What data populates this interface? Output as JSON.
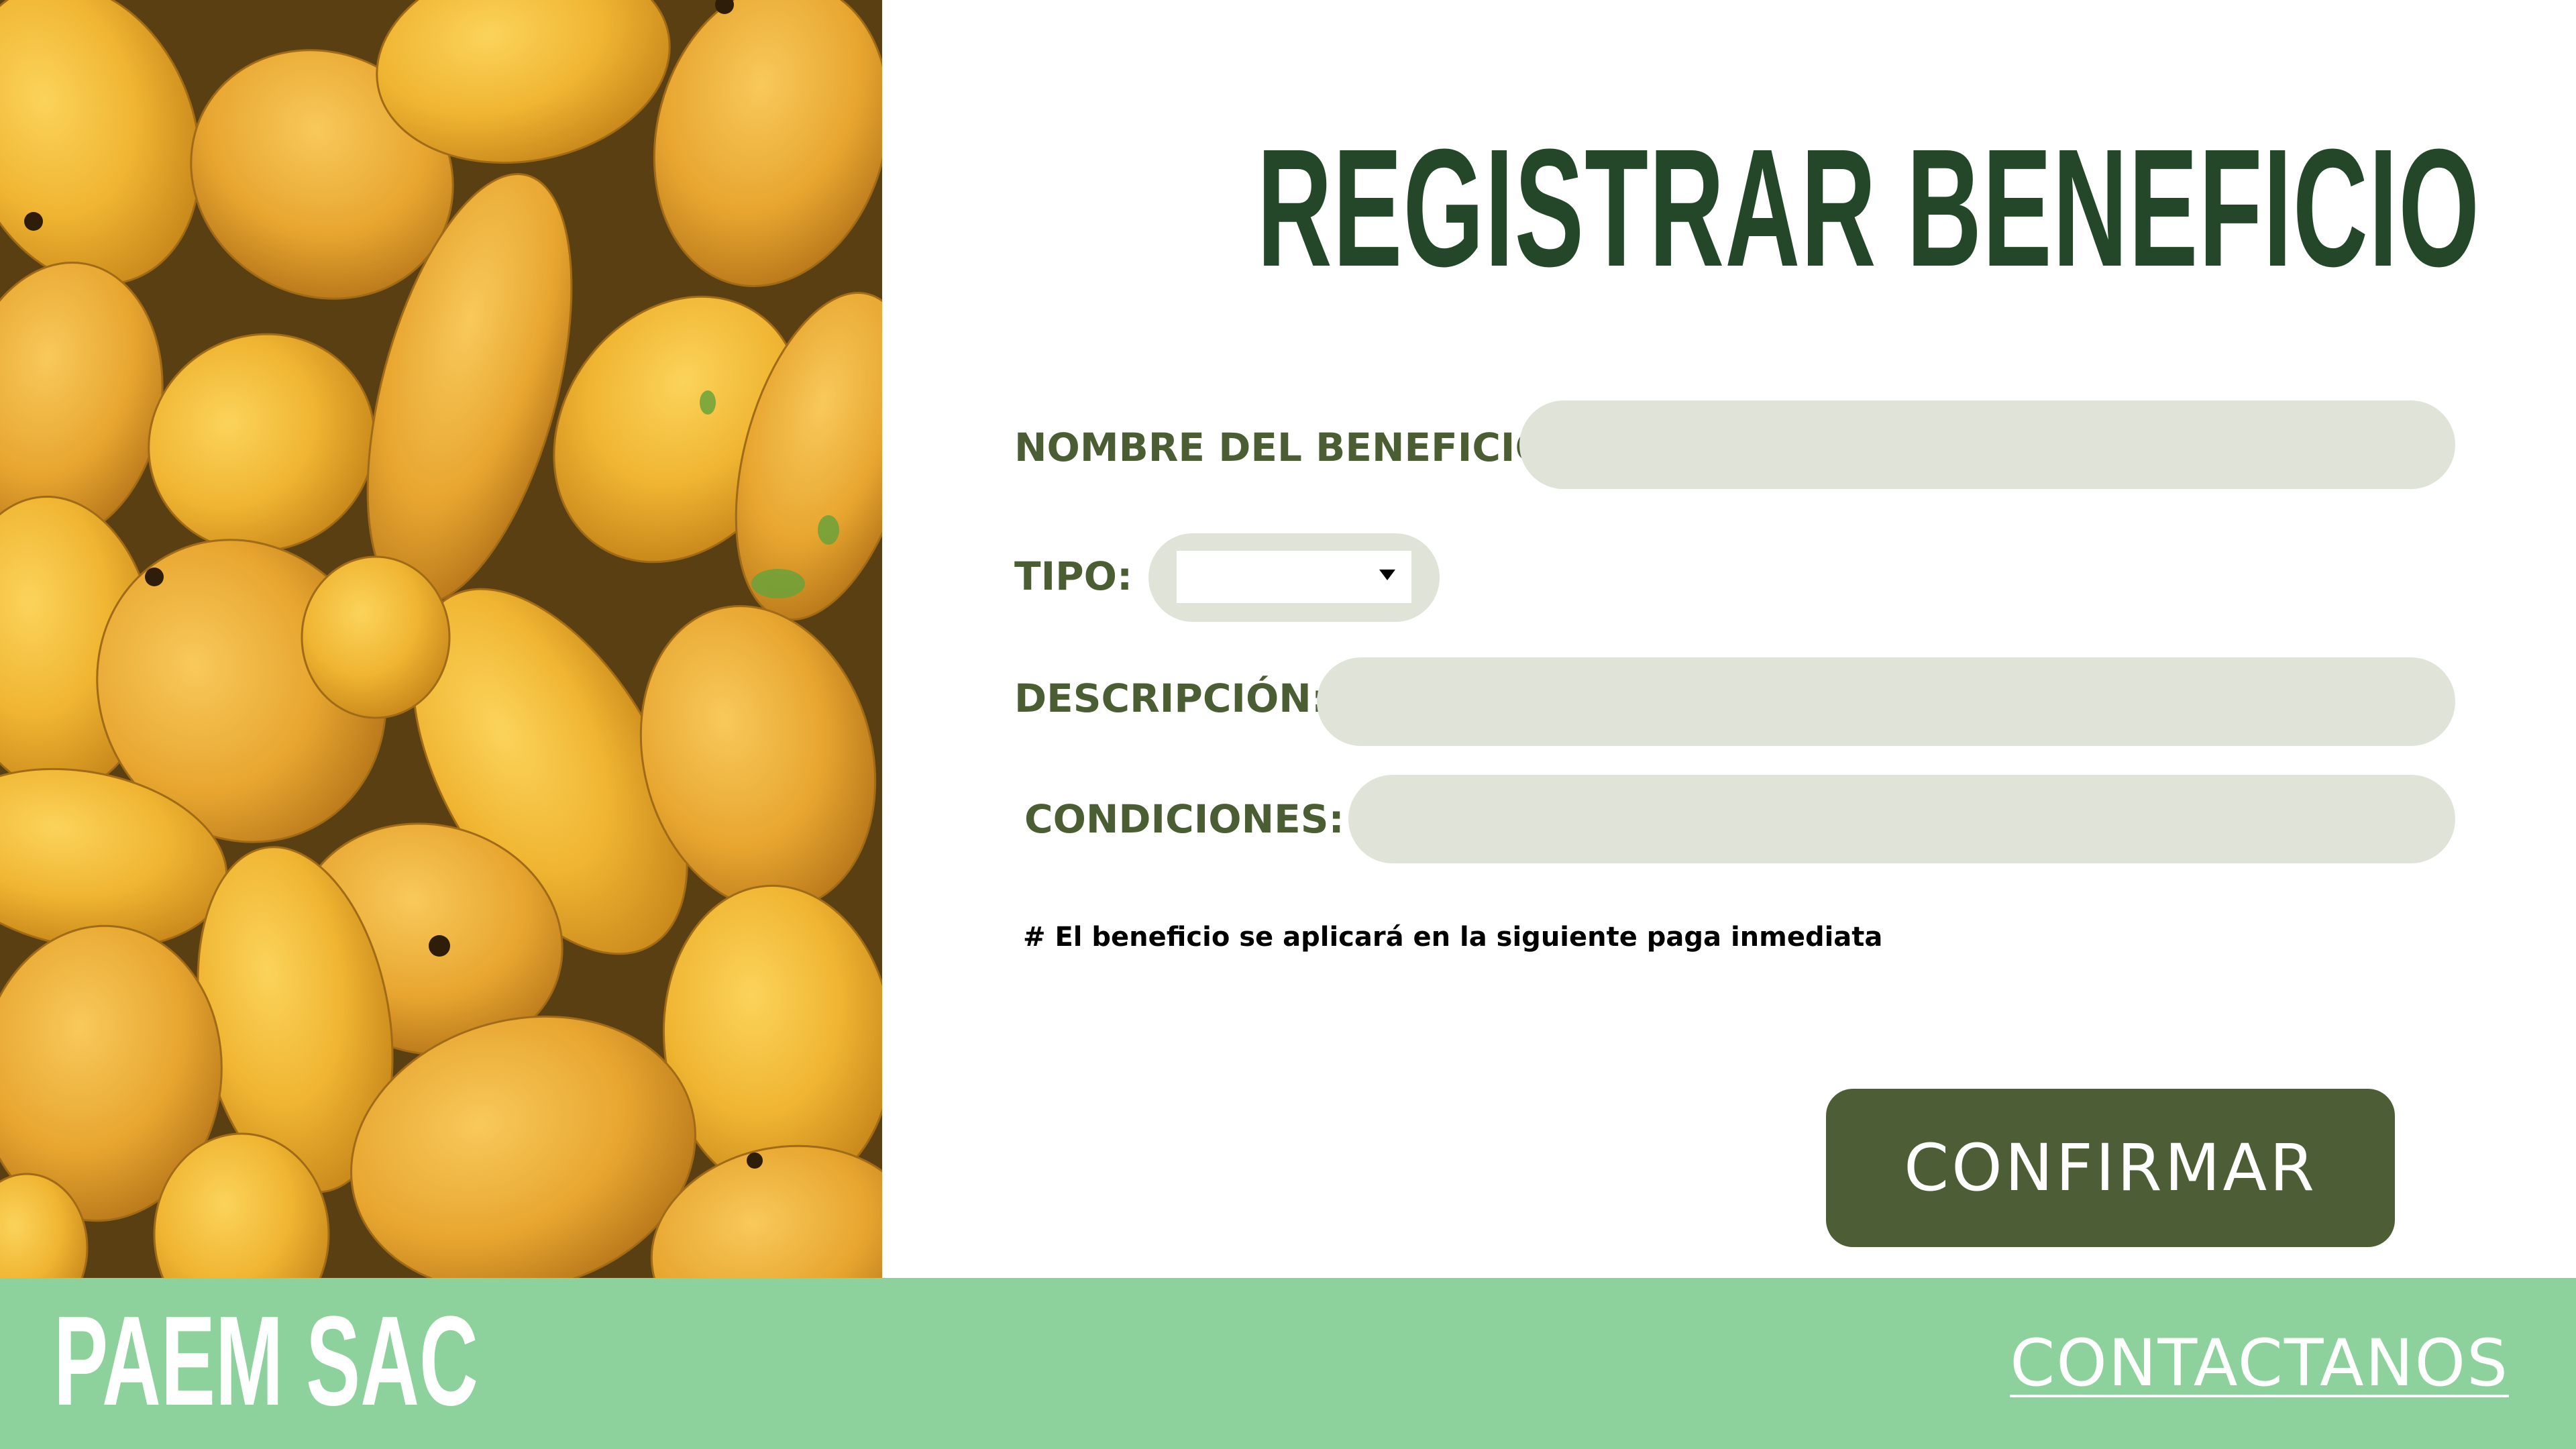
{
  "page": {
    "title": "REGISTRAR BENEFICIO"
  },
  "form": {
    "nombre": {
      "label": "NOMBRE DEL BENEFICIO:",
      "value": "",
      "placeholder": ""
    },
    "tipo": {
      "label": "TIPO:",
      "selected": ""
    },
    "descripcion": {
      "label": "DESCRIPCIÓN:",
      "value": "",
      "placeholder": ""
    },
    "condiciones": {
      "label": "CONDICIONES:",
      "value": "",
      "placeholder": ""
    },
    "note": "# El beneficio se aplicará en la siguiente paga inmediata",
    "confirm_label": "CONFIRMAR"
  },
  "footer": {
    "brand": "PAEM SAC",
    "contact_label": "CONTACTANOS"
  },
  "colors": {
    "title": "#24472a",
    "label": "#4b5e33",
    "field_bg": "#dfe3d8",
    "button_bg": "#4d5e36",
    "footer_bg": "#8dd19c"
  }
}
